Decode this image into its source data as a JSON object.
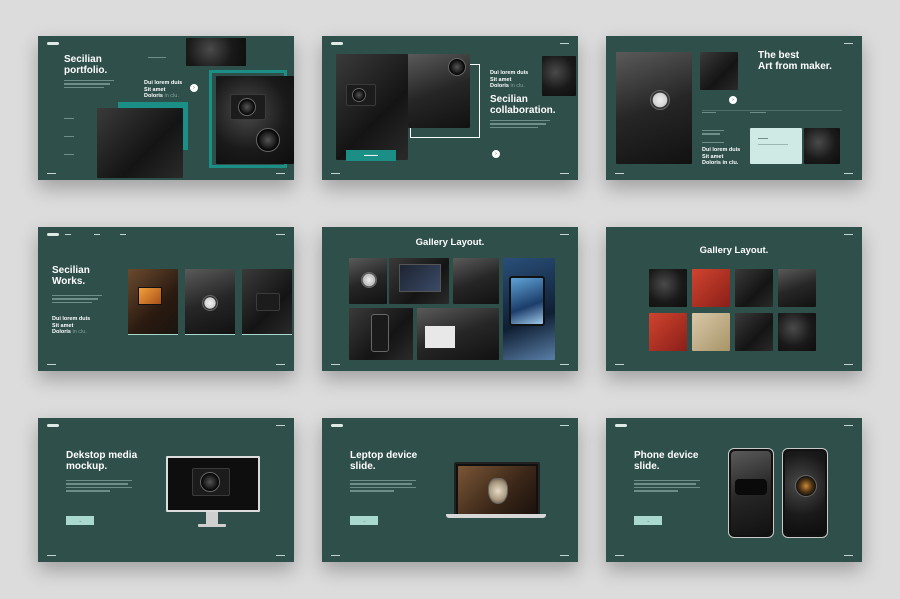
{
  "slides": [
    {
      "title": "Secilian\nportfolio.",
      "sub_bold": "Dui lorem duis\nSit amet\nDoloris",
      "sub_muted": "in clu.",
      "button_icon": "arrow-right-icon"
    },
    {
      "title": "Secilian\ncollaboration.",
      "sub_bold": "Dui lorem duis\nSit amet\nDoloris",
      "sub_muted": "in clu.",
      "button_icon": "arrow-right-icon"
    },
    {
      "title": "The best\nArt from maker.",
      "sub_bold": "Dui lorem duis\nSit amet\nDoloris in clu.",
      "button_icon": "arrow-right-icon"
    },
    {
      "title": "Secilian\nWorks.",
      "sub_bold": "Dui lorem duis\nSit amet\nDoloris",
      "sub_muted": "in clu."
    },
    {
      "title": "Gallery Layout."
    },
    {
      "title": "Gallery Layout."
    },
    {
      "title": "Dekstop media\nmockup.",
      "button_icon": "arrow-right-icon"
    },
    {
      "title": "Leptop device\nslide.",
      "button_icon": "arrow-right-icon"
    },
    {
      "title": "Phone device\nslide.",
      "button_icon": "arrow-right-icon"
    }
  ],
  "colors": {
    "slide_bg": "#2f4f4b",
    "accent_teal": "#1b8f86",
    "accent_mint": "#a9d8cf",
    "page_bg": "#dcdcdc"
  }
}
